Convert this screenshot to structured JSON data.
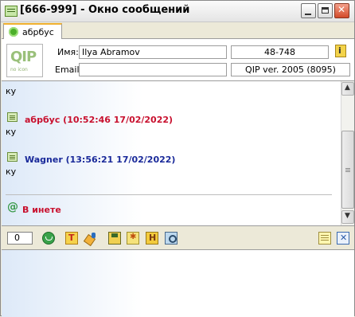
{
  "window": {
    "title": "[666-999] - Окно сообщений"
  },
  "tab": {
    "label": "абрбус"
  },
  "contact": {
    "name_label": "Имя:",
    "name_value": "Ilya  Abramov",
    "email_label": "Email:",
    "email_value": "",
    "uin": "48-748",
    "client": "QIP ver. 2005 (8095)",
    "logo_text": "QIP",
    "logo_subtext": "no icon"
  },
  "history": {
    "top_text": "ку",
    "messages": [
      {
        "author": "абрбус (10:52:46 17/02/2022)",
        "text": "ку",
        "color": "#c8102e"
      },
      {
        "author": "Wagner (13:56:21 17/02/2022)",
        "text": "ку",
        "color": "#1a2a9a"
      }
    ],
    "status_symbol": "@",
    "status_text": "В инете",
    "status_color": "#c8102e"
  },
  "toolbar": {
    "char_count": "0"
  },
  "input": {
    "text": ""
  }
}
